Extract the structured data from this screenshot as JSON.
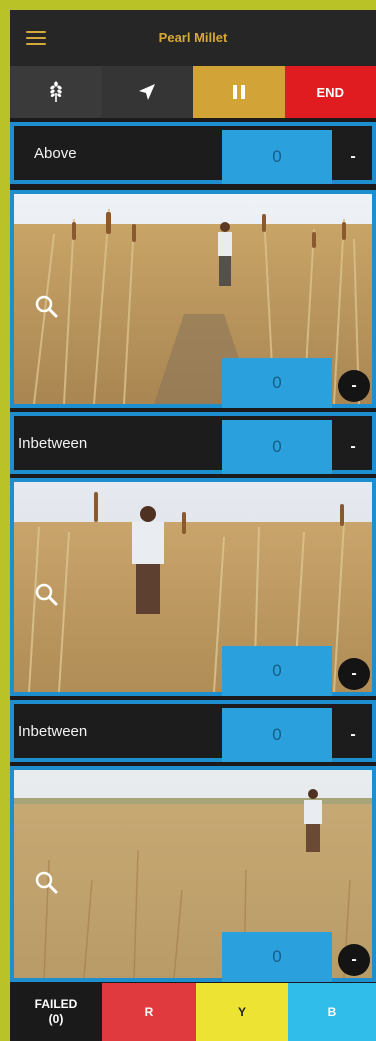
{
  "header": {
    "title": "Pearl Millet",
    "menu_icon": "hamburger-menu-icon"
  },
  "toolbar": {
    "crop_icon": "millet-grain-icon",
    "location_icon": "navigation-arrow-icon",
    "pause_icon": "pause-icon",
    "end_label": "END",
    "colors": {
      "crop": "#3a3a3a",
      "location": "#353535",
      "pause": "#d2a437",
      "end": "#e11c21"
    }
  },
  "sections": [
    {
      "label": "Above",
      "count": "0",
      "minus": "-"
    },
    {
      "photo_count": "0",
      "minus": "-",
      "zoom_icon": "magnifier-icon"
    },
    {
      "label": "Inbetween",
      "count": "0",
      "minus": "-"
    },
    {
      "photo_count": "0",
      "minus": "-",
      "zoom_icon": "magnifier-icon"
    },
    {
      "label": "Inbetween",
      "count": "0",
      "minus": "-"
    },
    {
      "photo_count": "0",
      "minus": "-",
      "zoom_icon": "magnifier-icon"
    }
  ],
  "bottom": {
    "failed_label": "FAILED",
    "failed_count": "(0)",
    "r_label": "R",
    "y_label": "Y",
    "b_label": "B",
    "colors": {
      "failed": "#1a1a1a",
      "r": "#e03a3f",
      "y": "#ece333",
      "b": "#31bde9"
    }
  },
  "accent_color": "#1d8fcf"
}
